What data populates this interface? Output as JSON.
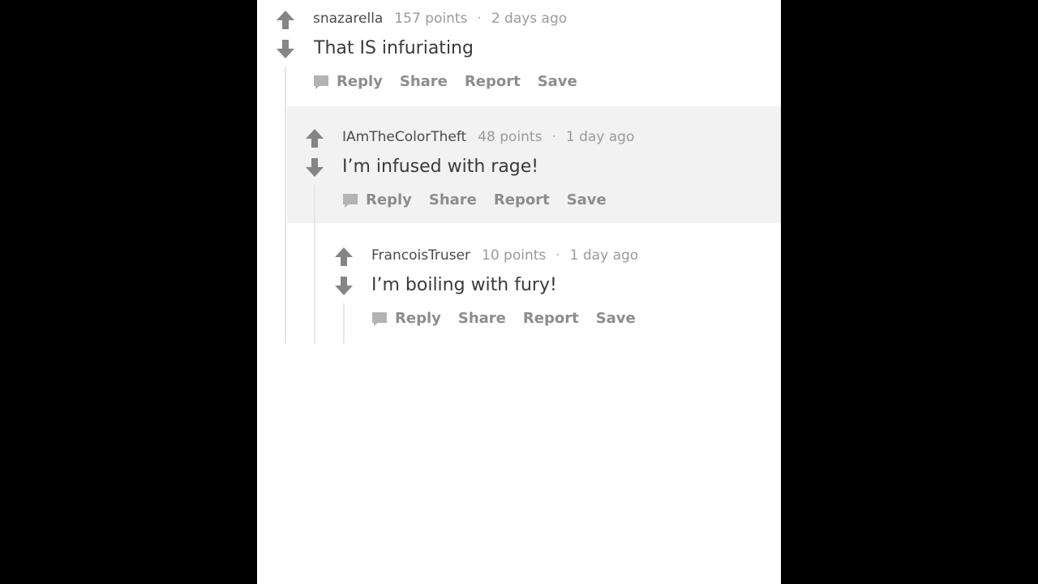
{
  "comments": [
    {
      "username": "snazarella",
      "points": "157 points",
      "separator": "·",
      "time": "2 days ago",
      "text": "That IS infuriating",
      "actions": {
        "reply": "Reply",
        "share": "Share",
        "report": "Report",
        "save": "Save"
      }
    },
    {
      "username": "IAmTheColorTheft",
      "points": "48 points",
      "separator": "·",
      "time": "1 day ago",
      "text": "I’m infused with rage!",
      "actions": {
        "reply": "Reply",
        "share": "Share",
        "report": "Report",
        "save": "Save"
      }
    },
    {
      "username": "FrancoisTruser",
      "points": "10 points",
      "separator": "·",
      "time": "1 day ago",
      "text": "I’m boiling with fury!",
      "actions": {
        "reply": "Reply",
        "share": "Share",
        "report": "Report",
        "save": "Save"
      }
    }
  ],
  "icons": {
    "upvote": "upvote-arrow-icon",
    "downvote": "downvote-arrow-icon",
    "comment": "comment-bubble-icon"
  },
  "colors": {
    "frame_background": "#ffffff",
    "nested_highlight": "#f2f2f2",
    "arrow": "#858585",
    "meta_text": "#9a9a9a",
    "action_text": "#8d8d8d"
  }
}
